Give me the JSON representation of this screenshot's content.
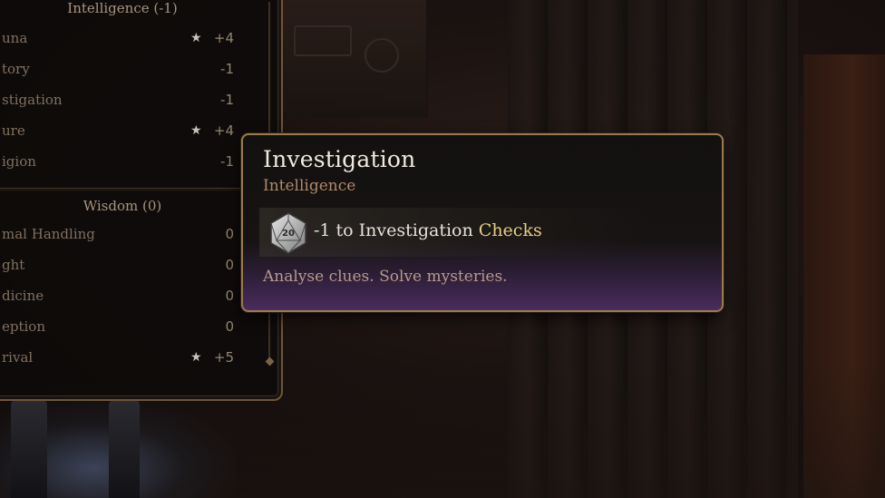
{
  "skills_panel": {
    "intelligence_header": "Intelligence (-1)",
    "intelligence_skills": [
      {
        "name": "una",
        "star": true,
        "value": "+4"
      },
      {
        "name": "tory",
        "star": false,
        "value": "-1"
      },
      {
        "name": "stigation",
        "star": false,
        "value": "-1"
      },
      {
        "name": "ure",
        "star": true,
        "value": "+4"
      },
      {
        "name": "igion",
        "star": false,
        "value": "-1"
      }
    ],
    "wisdom_header": "Wisdom (0)",
    "wisdom_skills": [
      {
        "name": "mal Handling",
        "star": false,
        "value": "0"
      },
      {
        "name": "ght",
        "star": false,
        "value": "0"
      },
      {
        "name": "dicine",
        "star": false,
        "value": "0"
      },
      {
        "name": "eption",
        "star": false,
        "value": "0"
      },
      {
        "name": "rival",
        "star": true,
        "value": "+5"
      }
    ],
    "star_glyph": "★"
  },
  "tooltip": {
    "title": "Investigation",
    "subtitle": "Intelligence",
    "die_label": "20",
    "die_icon": "d20-icon",
    "effect_prefix": "-1 to Investigation",
    "effect_highlight": "Checks",
    "description": "Analyse clues. Solve mysteries.",
    "accent_color": "#e5cf84",
    "subtitle_color": "#b3876a",
    "border_color": "#9a7a4c"
  }
}
